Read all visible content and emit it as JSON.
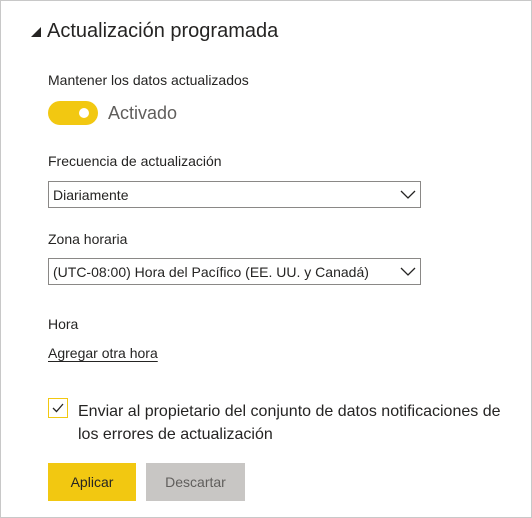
{
  "section": {
    "title": "Actualización programada",
    "expanded": true
  },
  "keep_updated": {
    "label": "Mantener los datos actualizados",
    "toggle_on": true,
    "toggle_text": "Activado",
    "accent_color": "#f2c811"
  },
  "frequency": {
    "label": "Frecuencia de actualización",
    "selected": "Diariamente"
  },
  "timezone": {
    "label": "Zona horaria",
    "selected": "(UTC-08:00) Hora del Pacífico (EE. UU. y Canadá)"
  },
  "time": {
    "label": "Hora",
    "add_link": "Agregar otra hora"
  },
  "notify": {
    "checked": true,
    "text": "Enviar al propietario del conjunto de datos notificaciones de los errores de actualización"
  },
  "buttons": {
    "apply": "Aplicar",
    "discard": "Descartar"
  },
  "icons": {
    "caret": "caret-down-right-icon",
    "chevron": "chevron-down-icon",
    "check": "checkmark-icon"
  }
}
